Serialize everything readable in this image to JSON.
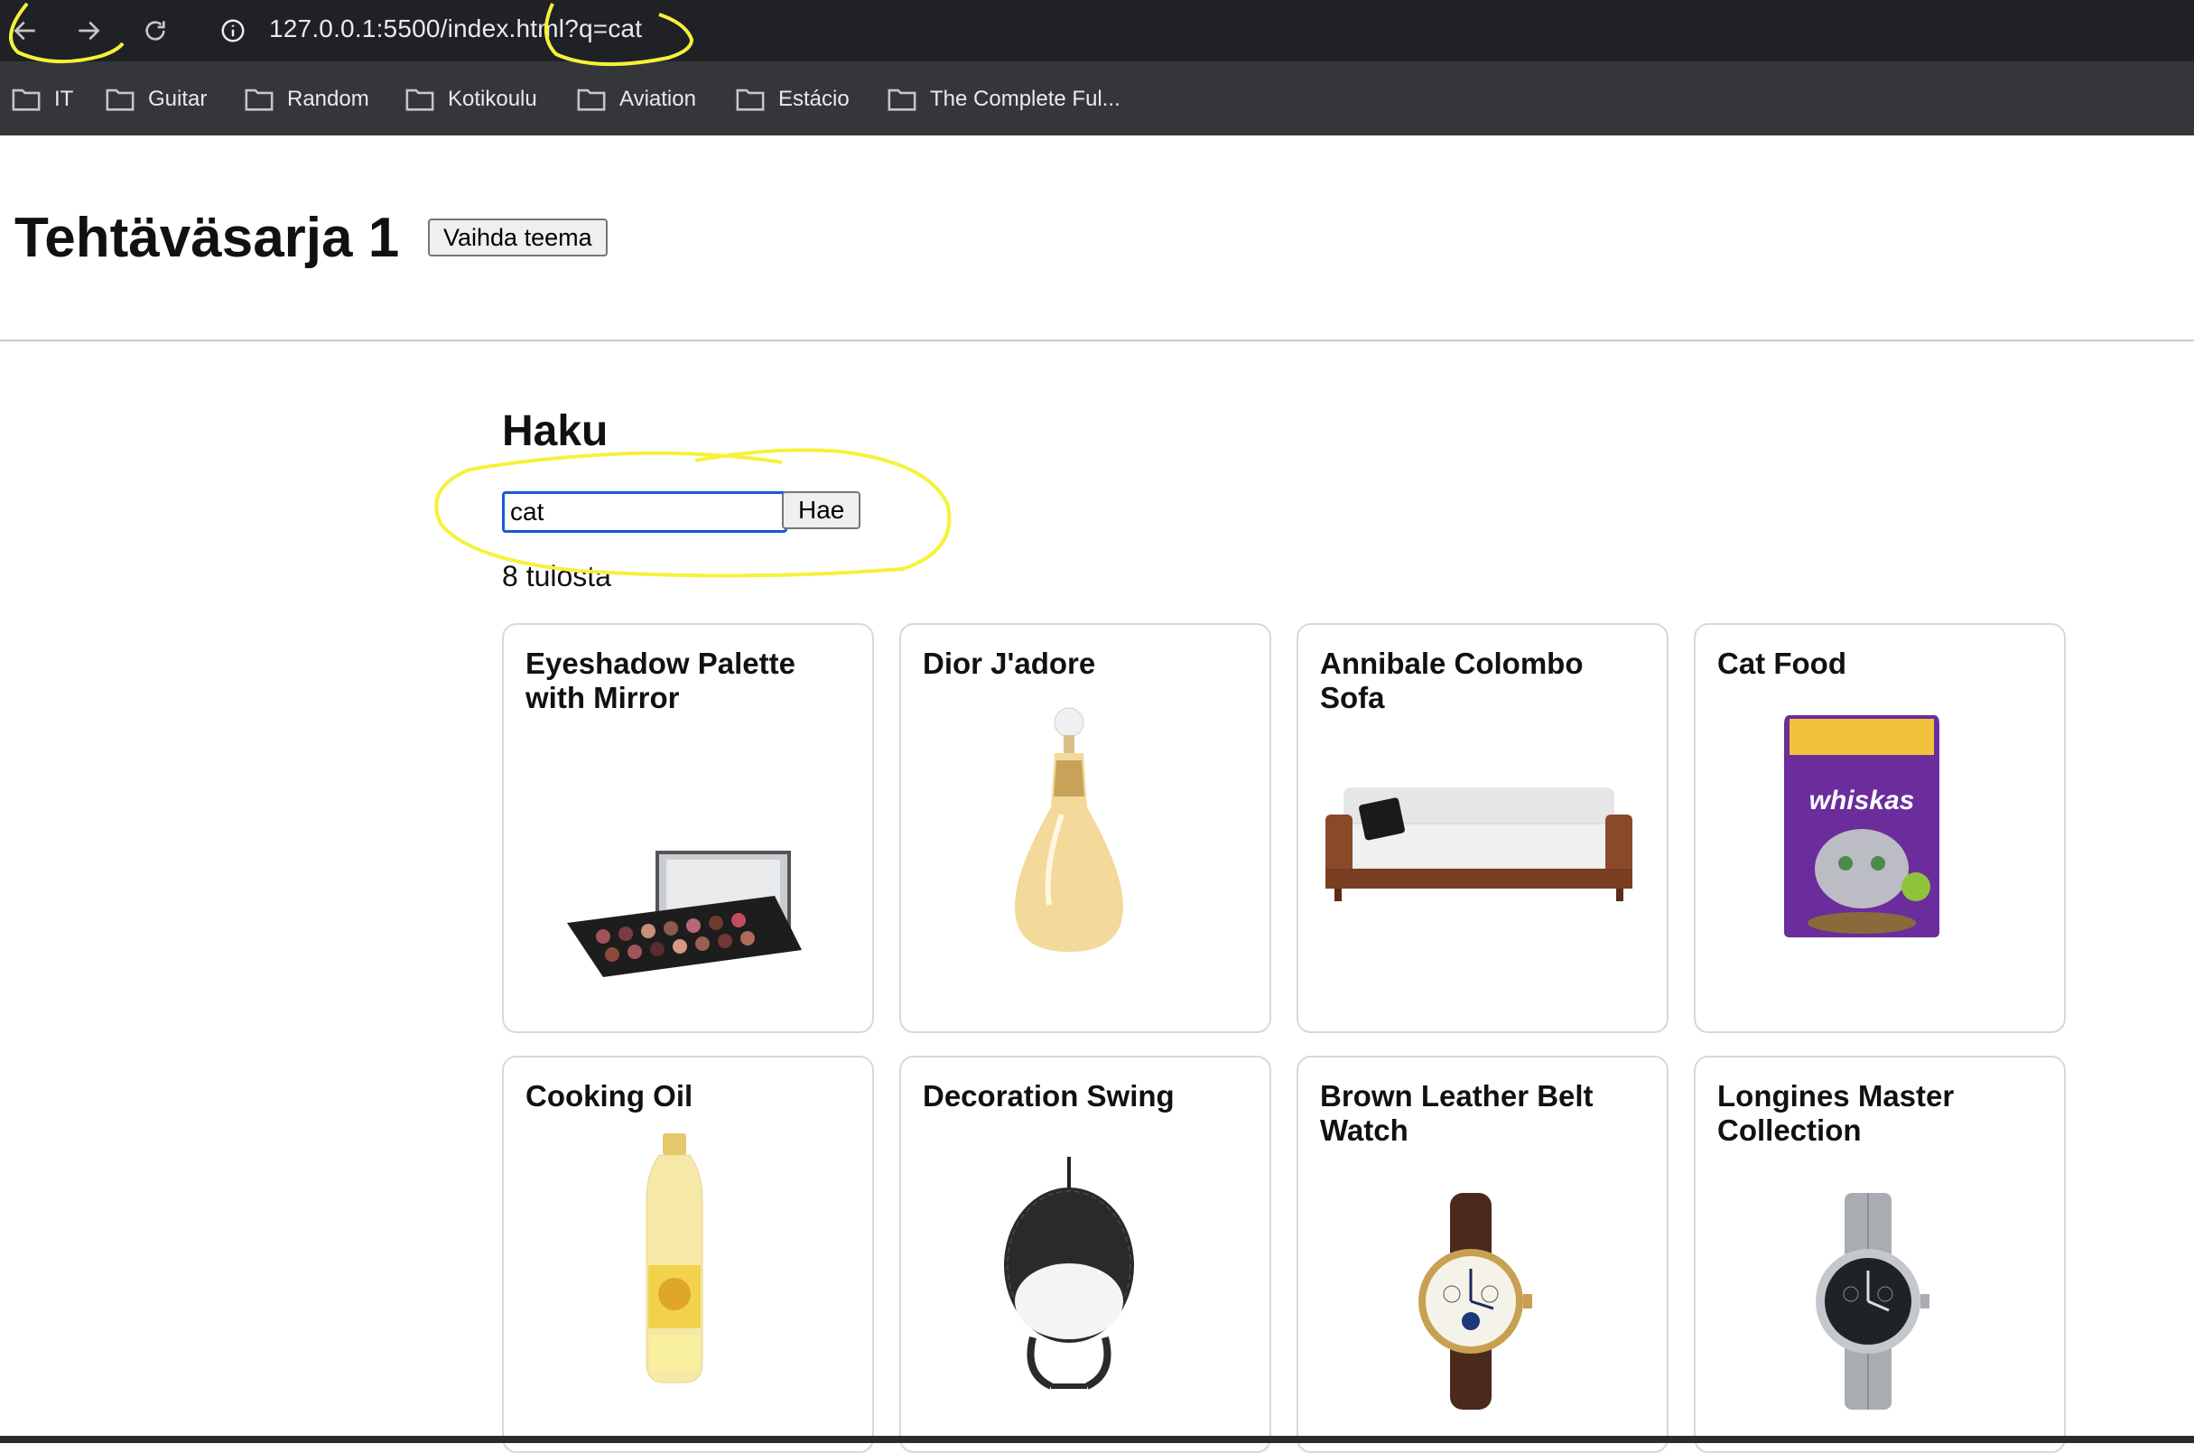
{
  "browser": {
    "url": "127.0.0.1:5500/index.html?q=cat",
    "bookmarks": [
      "IT",
      "Guitar",
      "Random",
      "Kotikoulu",
      "Aviation",
      "Estácio",
      "The Complete Ful..."
    ]
  },
  "header": {
    "title": "Tehtäväsarja 1",
    "theme_button": "Vaihda teema"
  },
  "search": {
    "title": "Haku",
    "query": "cat",
    "button": "Hae",
    "result_count": "8 tulosta"
  },
  "products": [
    {
      "name": "Eyeshadow Palette with Mirror",
      "icon": "eyeshadow-palette-image"
    },
    {
      "name": "Dior J'adore",
      "icon": "perfume-bottle-image"
    },
    {
      "name": "Annibale Colombo Sofa",
      "icon": "sofa-image"
    },
    {
      "name": "Cat Food",
      "icon": "cat-food-pouch-image"
    },
    {
      "name": "Cooking Oil",
      "icon": "oil-bottle-image"
    },
    {
      "name": "Decoration Swing",
      "icon": "hanging-swing-chair-image"
    },
    {
      "name": "Brown Leather Belt Watch",
      "icon": "leather-watch-image"
    },
    {
      "name": "Longines Master Collection",
      "icon": "steel-watch-image"
    }
  ],
  "colors": {
    "annotation": "#f5f23a",
    "input_focus": "#1a56db",
    "cat_food_purple": "#6b2c9c"
  }
}
